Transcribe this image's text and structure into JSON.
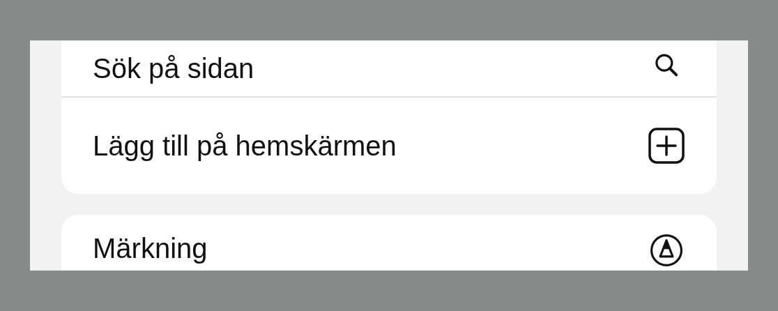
{
  "sections": [
    {
      "items": [
        {
          "kind": "search",
          "label": "Sök på sidan"
        },
        {
          "kind": "add",
          "label": "Lägg till på hemskärmen"
        }
      ]
    },
    {
      "items": [
        {
          "kind": "markup",
          "label": "Märkning"
        }
      ]
    }
  ]
}
